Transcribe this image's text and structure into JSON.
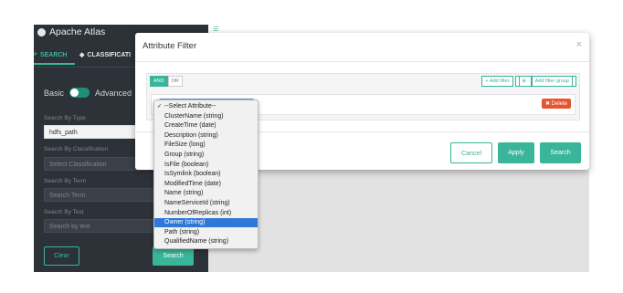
{
  "app": {
    "brand": "Apache Atlas"
  },
  "tabs": {
    "search": "SEARCH",
    "classification": "CLASSIFICATI"
  },
  "sidebar": {
    "mode_basic": "Basic",
    "mode_advanced": "Advanced",
    "search_by_type_label": "Search By Type",
    "type_value": "hdfs_path",
    "search_by_classification_label": "Search By Classification",
    "classification_placeholder": "Select Classification",
    "search_by_term_label": "Search By Term",
    "term_placeholder": "Search Term",
    "search_by_text_label": "Search By Text",
    "text_placeholder": "Search by text",
    "clear_label": "Clear",
    "search_label": "Search"
  },
  "modal": {
    "title": "Attribute Filter",
    "close": "×",
    "and_label": "AND",
    "or_label": "OR",
    "add_filter": "+ Add filter",
    "add_filter_group": "Add filter group",
    "delete_label": "✖ Delete",
    "select_value": "",
    "cancel_label": "Cancel",
    "apply_label": "Apply",
    "search_label": "Search"
  },
  "dropdown": {
    "options": [
      "--Select Attribute--",
      "ClusterName (string)",
      "CreateTime (date)",
      "Description (string)",
      "FileSize (long)",
      "Group (string)",
      "IsFile (boolean)",
      "IsSymlink (boolean)",
      "ModifiedTime (date)",
      "Name (string)",
      "NameServiceId (string)",
      "NumberOfReplicas (int)",
      "Owner (string)",
      "Path (string)",
      "QualifiedName (string)"
    ],
    "checked_option": "--Select Attribute--",
    "highlighted_option": "Owner (string)"
  },
  "colors": {
    "accent": "#39b59a",
    "sidebar_bg": "#2d3239",
    "delete": "#e45532",
    "highlight": "#2f78d8"
  }
}
